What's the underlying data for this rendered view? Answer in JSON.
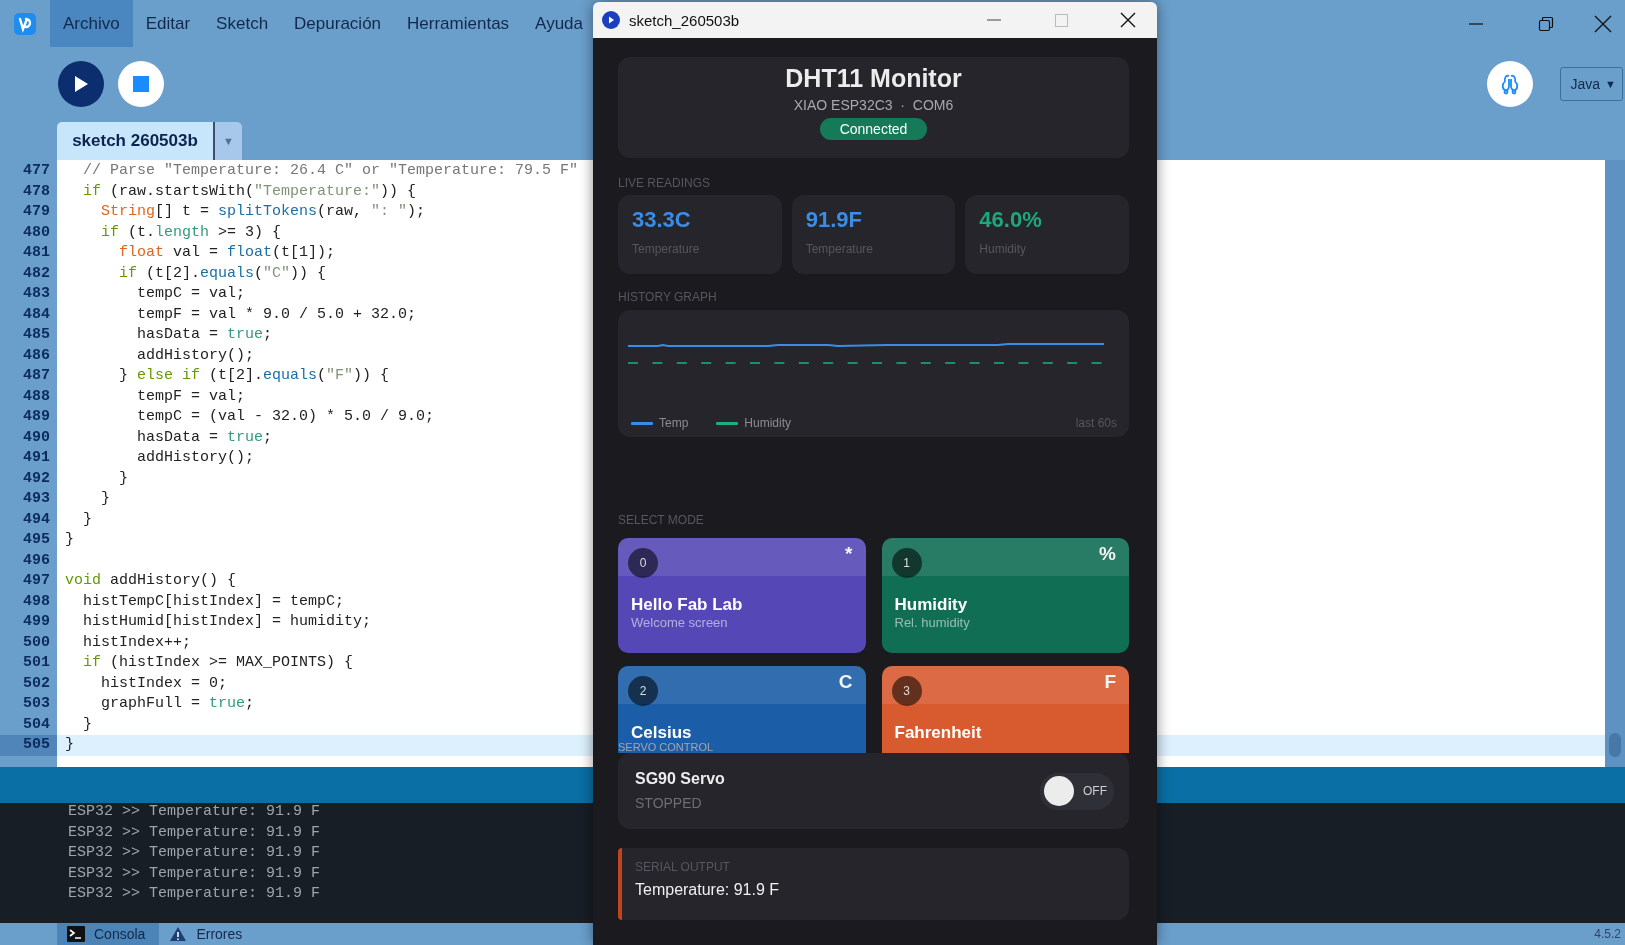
{
  "menu_bar": {
    "items": [
      {
        "label": "Archivo",
        "selected": true
      },
      {
        "label": "Editar",
        "selected": false
      },
      {
        "label": "Sketch",
        "selected": false
      },
      {
        "label": "Depuración",
        "selected": false
      },
      {
        "label": "Herramientas",
        "selected": false
      },
      {
        "label": "Ayuda",
        "selected": false
      }
    ]
  },
  "toolbar": {
    "mode": "Java",
    "mode_caret": "▼"
  },
  "tabs": [
    {
      "label": "sketch 260503b",
      "selected": true
    }
  ],
  "tab_menu_caret": "▼",
  "editor": {
    "lines": [
      {
        "number": "477",
        "current": false,
        "tokens": [
          {
            "kind": "comment",
            "text": "  // Parse \"Temperature: 26.4 C\" or \"Temperature: 79.5 F\""
          }
        ]
      },
      {
        "number": "478",
        "current": false,
        "tokens": [
          {
            "kind": "keyword",
            "text": "  if"
          },
          {
            "kind": "plain",
            "text": " (raw.startsWith("
          },
          {
            "kind": "string",
            "text": "\"Temperature:\""
          },
          {
            "kind": "plain",
            "text": ")) {"
          }
        ]
      },
      {
        "number": "479",
        "current": false,
        "tokens": [
          {
            "kind": "type",
            "text": "    String"
          },
          {
            "kind": "plain",
            "text": "[] t = "
          },
          {
            "kind": "function",
            "text": "splitTokens"
          },
          {
            "kind": "plain",
            "text": "(raw, "
          },
          {
            "kind": "string",
            "text": "\": \""
          },
          {
            "kind": "plain",
            "text": ");"
          }
        ]
      },
      {
        "number": "480",
        "current": false,
        "tokens": [
          {
            "kind": "keyword",
            "text": "    if"
          },
          {
            "kind": "plain",
            "text": " (t."
          },
          {
            "kind": "literal",
            "text": "length"
          },
          {
            "kind": "plain",
            "text": " >= 3) {"
          }
        ]
      },
      {
        "number": "481",
        "current": false,
        "tokens": [
          {
            "kind": "type",
            "text": "      float"
          },
          {
            "kind": "plain",
            "text": " val = "
          },
          {
            "kind": "function",
            "text": "float"
          },
          {
            "kind": "plain",
            "text": "(t[1]);"
          }
        ]
      },
      {
        "number": "482",
        "current": false,
        "tokens": [
          {
            "kind": "keyword",
            "text": "      if"
          },
          {
            "kind": "plain",
            "text": " (t[2]."
          },
          {
            "kind": "function",
            "text": "equals"
          },
          {
            "kind": "plain",
            "text": "("
          },
          {
            "kind": "string",
            "text": "\"C\""
          },
          {
            "kind": "plain",
            "text": ")) {"
          }
        ]
      },
      {
        "number": "483",
        "current": false,
        "tokens": [
          {
            "kind": "plain",
            "text": "        tempC = val;"
          }
        ]
      },
      {
        "number": "484",
        "current": false,
        "tokens": [
          {
            "kind": "plain",
            "text": "        tempF = val * 9.0 / 5.0 + 32.0;"
          }
        ]
      },
      {
        "number": "485",
        "current": false,
        "tokens": [
          {
            "kind": "plain",
            "text": "        hasData = "
          },
          {
            "kind": "literal",
            "text": "true"
          },
          {
            "kind": "plain",
            "text": ";"
          }
        ]
      },
      {
        "number": "486",
        "current": false,
        "tokens": [
          {
            "kind": "plain",
            "text": "        addHistory();"
          }
        ]
      },
      {
        "number": "487",
        "current": false,
        "tokens": [
          {
            "kind": "plain",
            "text": "      } "
          },
          {
            "kind": "keyword",
            "text": "else if"
          },
          {
            "kind": "plain",
            "text": " (t[2]."
          },
          {
            "kind": "function",
            "text": "equals"
          },
          {
            "kind": "plain",
            "text": "("
          },
          {
            "kind": "string",
            "text": "\"F\""
          },
          {
            "kind": "plain",
            "text": ")) {"
          }
        ]
      },
      {
        "number": "488",
        "current": false,
        "tokens": [
          {
            "kind": "plain",
            "text": "        tempF = val;"
          }
        ]
      },
      {
        "number": "489",
        "current": false,
        "tokens": [
          {
            "kind": "plain",
            "text": "        tempC = (val - 32.0) * 5.0 / 9.0;"
          }
        ]
      },
      {
        "number": "490",
        "current": false,
        "tokens": [
          {
            "kind": "plain",
            "text": "        hasData = "
          },
          {
            "kind": "literal",
            "text": "true"
          },
          {
            "kind": "plain",
            "text": ";"
          }
        ]
      },
      {
        "number": "491",
        "current": false,
        "tokens": [
          {
            "kind": "plain",
            "text": "        addHistory();"
          }
        ]
      },
      {
        "number": "492",
        "current": false,
        "tokens": [
          {
            "kind": "plain",
            "text": "      }"
          }
        ]
      },
      {
        "number": "493",
        "current": false,
        "tokens": [
          {
            "kind": "plain",
            "text": "    }"
          }
        ]
      },
      {
        "number": "494",
        "current": false,
        "tokens": [
          {
            "kind": "plain",
            "text": "  }"
          }
        ]
      },
      {
        "number": "495",
        "current": false,
        "tokens": [
          {
            "kind": "plain",
            "text": "}"
          }
        ]
      },
      {
        "number": "496",
        "current": false
      },
      {
        "number": "497",
        "current": false,
        "tokens": [
          {
            "kind": "keyword",
            "text": "void"
          },
          {
            "kind": "plain",
            "text": " addHistory() {"
          }
        ]
      },
      {
        "number": "498",
        "current": false,
        "tokens": [
          {
            "kind": "plain",
            "text": "  histTempC[histIndex] = tempC;"
          }
        ]
      },
      {
        "number": "499",
        "current": false,
        "tokens": [
          {
            "kind": "plain",
            "text": "  histHumid[histIndex] = humidity;"
          }
        ]
      },
      {
        "number": "500",
        "current": false,
        "tokens": [
          {
            "kind": "plain",
            "text": "  histIndex++;"
          }
        ]
      },
      {
        "number": "501",
        "current": false,
        "tokens": [
          {
            "kind": "keyword",
            "text": "  if"
          },
          {
            "kind": "plain",
            "text": " (histIndex >= MAX_POINTS) {"
          }
        ]
      },
      {
        "number": "502",
        "current": false,
        "tokens": [
          {
            "kind": "plain",
            "text": "    histIndex = 0;"
          }
        ]
      },
      {
        "number": "503",
        "current": false,
        "tokens": [
          {
            "kind": "plain",
            "text": "    graphFull = "
          },
          {
            "kind": "literal",
            "text": "true"
          },
          {
            "kind": "plain",
            "text": ";"
          }
        ]
      },
      {
        "number": "504",
        "current": false,
        "tokens": [
          {
            "kind": "plain",
            "text": "  }"
          }
        ]
      },
      {
        "number": "505",
        "current": true,
        "tokens": [
          {
            "kind": "plain",
            "text": "}"
          }
        ]
      }
    ]
  },
  "console": {
    "lines": [
      "ESP32 >> Temperature: 91.9 F",
      "ESP32 >> Temperature: 91.9 F",
      "ESP32 >> Temperature: 91.9 F",
      "ESP32 >> Temperature: 91.9 F",
      "ESP32 >> Temperature: 91.9 F"
    ]
  },
  "bottom_tabs": [
    {
      "label": "Consola",
      "selected": true,
      "kind": "console"
    },
    {
      "label": "Errores",
      "selected": false,
      "kind": "errors"
    }
  ],
  "version": "4.5.2",
  "sketch_window": {
    "title": "sketch_260503b",
    "header": {
      "title": "DHT11 Monitor",
      "subtitle": "XIAO ESP32C3  ·  COM6",
      "status": "Connected"
    },
    "live_label": "LIVE READINGS",
    "readings": [
      {
        "value": "33.3C",
        "label": "Temperature",
        "color": "#3a8de6"
      },
      {
        "value": "91.9F",
        "label": "Temperature",
        "color": "#3a8de6"
      },
      {
        "value": "46.0%",
        "label": "Humidity",
        "color": "#1fa67a"
      }
    ],
    "graph_label": "HISTORY GRAPH",
    "legend": [
      {
        "label": "Temp",
        "color": "#3a8de6"
      },
      {
        "label": "Humidity",
        "color": "#1fae82"
      }
    ],
    "graph_range": "last 60s",
    "mode_label": "SELECT MODE",
    "modes": [
      {
        "number": "0",
        "title": "Hello Fab Lab",
        "subtitle": "Welcome screen",
        "symbol": "*",
        "color": "#5548b6"
      },
      {
        "number": "1",
        "title": "Humidity",
        "subtitle": "Rel. humidity",
        "symbol": "%",
        "color": "#106e54"
      },
      {
        "number": "2",
        "title": "Celsius",
        "symbol": "C",
        "color": "#1b5da6"
      },
      {
        "number": "3",
        "title": "Fahrenheit",
        "symbol": "F",
        "color": "#d85a2f"
      }
    ],
    "servo": {
      "section_label": "SERVO CONTROL",
      "name": "SG90 Servo",
      "status": "STOPPED",
      "on": false,
      "switch_label": "OFF"
    },
    "serial": {
      "label": "SERIAL OUTPUT",
      "text": "Temperature: 91.9 F"
    }
  }
}
